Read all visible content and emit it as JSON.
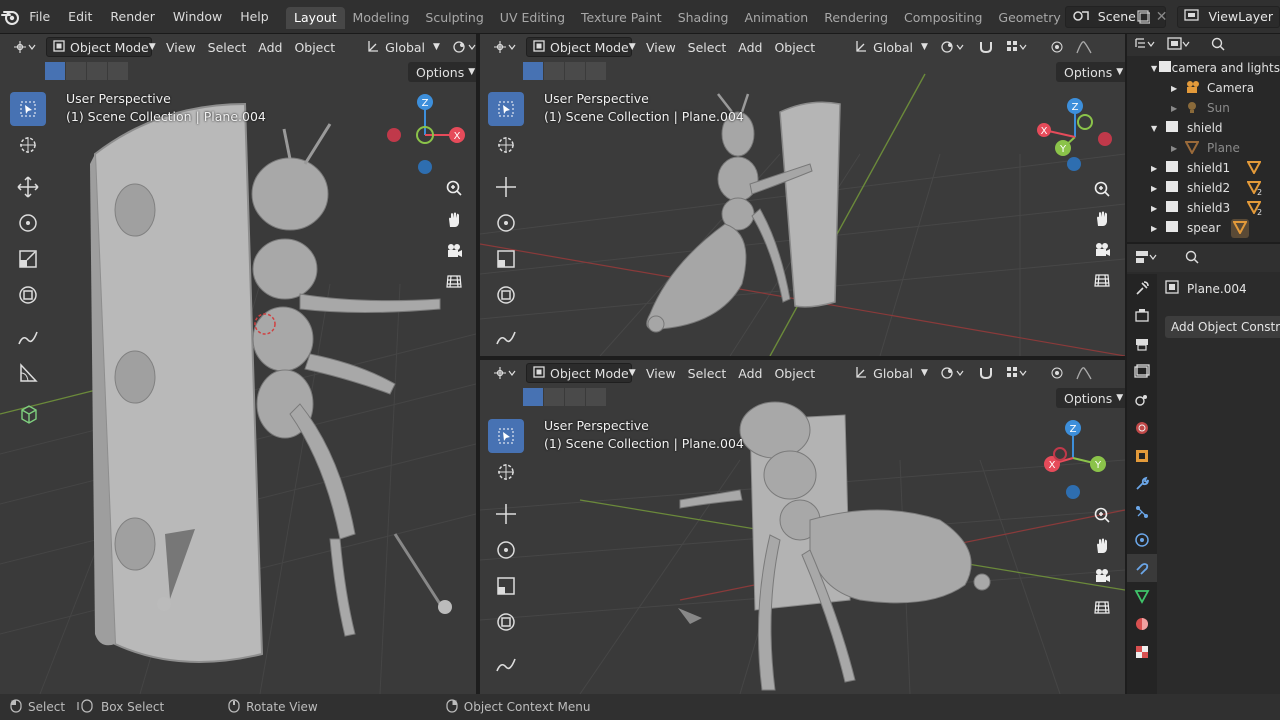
{
  "app": {
    "menus": [
      "File",
      "Edit",
      "Render",
      "Window",
      "Help"
    ],
    "workspaces": [
      "Layout",
      "Modeling",
      "Sculpting",
      "UV Editing",
      "Texture Paint",
      "Shading",
      "Animation",
      "Rendering",
      "Compositing",
      "Geometry Nod"
    ],
    "active_workspace": "Layout",
    "scene_name": "Scene",
    "view_layer": "ViewLayer"
  },
  "viewport_header": {
    "mode": "Object Mode",
    "view": "View",
    "select": "Select",
    "add": "Add",
    "object": "Object",
    "orientation": "Global",
    "options": "Options"
  },
  "viewports": [
    {
      "perspective": "User Perspective",
      "collection": "(1) Scene Collection | Plane.004"
    },
    {
      "perspective": "User Perspective",
      "collection": "(1) Scene Collection | Plane.004"
    },
    {
      "perspective": "User Perspective",
      "collection": "(1) Scene Collection | Plane.004"
    }
  ],
  "gizmo": {
    "x": "X",
    "y": "Y",
    "z": "Z",
    "colors": {
      "x": "#e64b5a",
      "y": "#8bc34a",
      "z": "#3d8fdb"
    }
  },
  "outliner": {
    "rows": [
      {
        "label": "camera and lights",
        "indent": 1,
        "dim": false,
        "icon": "collection-icon",
        "expanded": true
      },
      {
        "label": "Camera",
        "indent": 2,
        "dim": false,
        "icon": "camera-icon",
        "expanded": false
      },
      {
        "label": "Sun",
        "indent": 2,
        "dim": true,
        "icon": "light-icon",
        "expanded": false
      },
      {
        "label": "shield",
        "indent": 1,
        "dim": false,
        "icon": "collection-icon",
        "expanded": true
      },
      {
        "label": "Plane",
        "indent": 2,
        "dim": true,
        "icon": "mesh-icon",
        "expanded": false
      },
      {
        "label": "shield1",
        "indent": 1,
        "dim": false,
        "icon": "collection-icon",
        "expanded": false
      },
      {
        "label": "shield2",
        "indent": 1,
        "dim": false,
        "icon": "collection-icon",
        "expanded": false
      },
      {
        "label": "shield3",
        "indent": 1,
        "dim": false,
        "icon": "collection-icon",
        "expanded": false
      },
      {
        "label": "spear",
        "indent": 1,
        "dim": false,
        "icon": "collection-icon",
        "expanded": false
      }
    ],
    "badges": {
      "shield2": "2",
      "shield3": "2"
    }
  },
  "properties": {
    "object_name": "Plane.004",
    "add_constraint": "Add Object Constraint"
  },
  "statusbar": {
    "select": "Select",
    "box_select": "Box Select",
    "rotate_view": "Rotate View",
    "context_menu": "Object Context Menu"
  },
  "colors": {
    "accent": "#4772b3",
    "header": "#303030",
    "viewport_bg": "#393939"
  }
}
